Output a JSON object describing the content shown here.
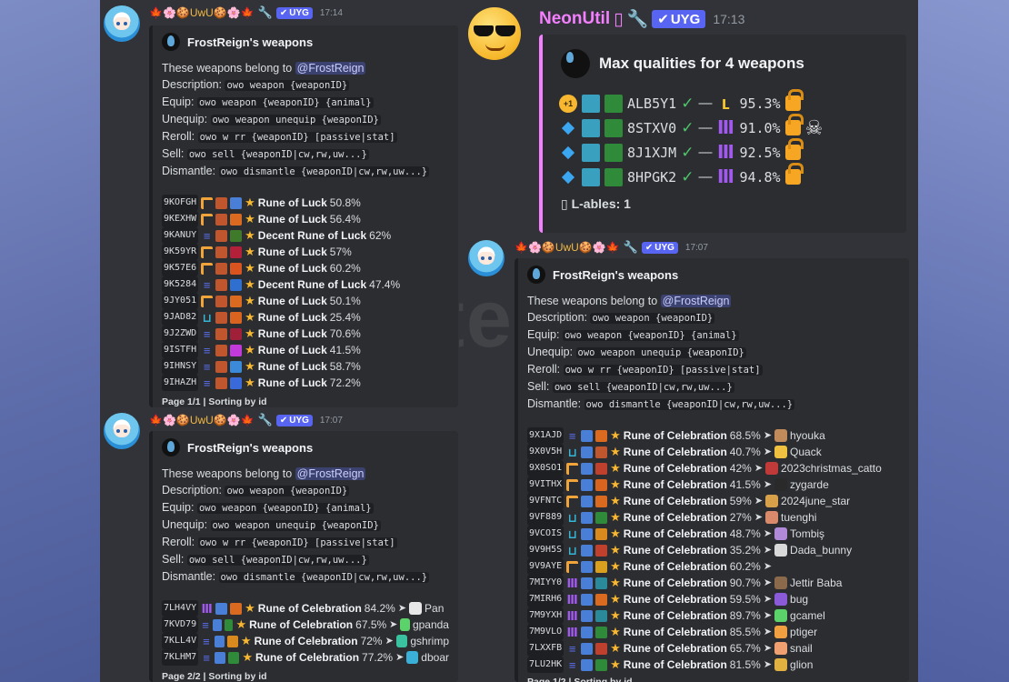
{
  "messages": {
    "left_top": {
      "author": "🍁🌸🍪UwU🍪🌸🍁",
      "tag": "UYG",
      "time": "17:14",
      "embed": {
        "title": "FrostReign's weapons",
        "intro_prefix": "These weapons belong to",
        "mention": "@FrostReign",
        "desc_label": "Description:",
        "desc_code": "owo weapon {weaponID}",
        "equip_label": "Equip:",
        "equip_code": "owo weapon {weaponID} {animal}",
        "unequip_label": "Unequip:",
        "unequip_code": "owo weapon unequip {weaponID}",
        "reroll_label": "Reroll:",
        "reroll_code": "owo w rr {weaponID} [passive|stat]",
        "sell_label": "Sell:",
        "sell_code": "owo sell {weaponID|cw,rw,uw...}",
        "dismantle_label": "Dismantle:",
        "dismantle_code": "owo dismantle {weaponID|cw,rw,uw...}",
        "rows": [
          {
            "id": "9KOFGH",
            "q": "C",
            "c1": "#c0562e",
            "c2": "#4a7fd8",
            "name": "Rune of Luck",
            "pct": "50.8%"
          },
          {
            "id": "9KEXHW",
            "q": "C",
            "c1": "#c0562e",
            "c2": "#d96a1f",
            "name": "Rune of Luck",
            "pct": "56.4%"
          },
          {
            "id": "9KANUY",
            "q": "E",
            "c1": "#c0562e",
            "c2": "#3f7a2a",
            "name": "Decent Rune of Luck",
            "pct": "62%"
          },
          {
            "id": "9K59YR",
            "q": "C",
            "c1": "#c0562e",
            "c2": "#b3203a",
            "name": "Rune of Luck",
            "pct": "57%"
          },
          {
            "id": "9K57E6",
            "q": "C",
            "c1": "#c0562e",
            "c2": "#d9541f",
            "name": "Rune of Luck",
            "pct": "60.2%"
          },
          {
            "id": "9K5284",
            "q": "E",
            "c1": "#c0562e",
            "c2": "#2f6fd0",
            "name": "Decent Rune of Luck",
            "pct": "47.4%"
          },
          {
            "id": "9JY051",
            "q": "C",
            "c1": "#c0562e",
            "c2": "#d96a1f",
            "name": "Rune of Luck",
            "pct": "50.1%"
          },
          {
            "id": "9JAD82",
            "q": "U",
            "c1": "#c0562e",
            "c2": "#d9641f",
            "name": "Rune of Luck",
            "pct": "25.4%"
          },
          {
            "id": "9J2ZWD",
            "q": "E",
            "c1": "#c0562e",
            "c2": "#a0203a",
            "name": "Rune of Luck",
            "pct": "70.6%"
          },
          {
            "id": "9ISTFH",
            "q": "E",
            "c1": "#c0562e",
            "c2": "#c23ad9",
            "name": "Rune of Luck",
            "pct": "41.5%"
          },
          {
            "id": "9IHNSY",
            "q": "E",
            "c1": "#c0562e",
            "c2": "#3a8ad9",
            "name": "Rune of Luck",
            "pct": "58.7%"
          },
          {
            "id": "9IHAZH",
            "q": "E",
            "c1": "#c0562e",
            "c2": "#3a6ad9",
            "name": "Rune of Luck",
            "pct": "72.2%"
          }
        ],
        "footer": "Page 1/1 | Sorting by id"
      }
    },
    "left_bottom": {
      "author": "🍁🌸🍪UwU🍪🌸🍁",
      "tag": "UYG",
      "time": "17:07",
      "embed": {
        "title": "FrostReign's weapons",
        "intro_prefix": "These weapons belong to",
        "mention": "@FrostReign",
        "desc_label": "Description:",
        "desc_code": "owo weapon {weaponID}",
        "equip_label": "Equip:",
        "equip_code": "owo weapon {weaponID} {animal}",
        "unequip_label": "Unequip:",
        "unequip_code": "owo weapon unequip {weaponID}",
        "reroll_label": "Reroll:",
        "reroll_code": "owo w rr {weaponID} [passive|stat]",
        "sell_label": "Sell:",
        "sell_code": "owo sell {weaponID|cw,rw,uw...}",
        "dismantle_label": "Dismantle:",
        "dismantle_code": "owo dismantle {weaponID|cw,rw,uw...}",
        "rows": [
          {
            "id": "7LH4VY",
            "q": "M",
            "c1": "#4a7fd8",
            "c2": "#d96a1f",
            "name": "Rune of Celebration",
            "pct": "84.2%",
            "pet": "Pan",
            "petc": "#e8e8e8"
          },
          {
            "id": "7KVD79",
            "q": "E",
            "c1": "#4a7fd8",
            "c2": "#2f8a3a",
            "name": "Rune of Celebration",
            "pct": "67.5%",
            "pet": "gpanda",
            "petc": "#5bd36a"
          },
          {
            "id": "7KLL4V",
            "q": "E",
            "c1": "#4a7fd8",
            "c2": "#d98a1f",
            "name": "Rune of Celebration",
            "pct": "72%",
            "pet": "gshrimp",
            "petc": "#3ac2a0"
          },
          {
            "id": "7KLHM7",
            "q": "E",
            "c1": "#4a7fd8",
            "c2": "#2f8a3a",
            "name": "Rune of Celebration",
            "pct": "77.2%",
            "pet": "dboar",
            "petc": "#3ab0d9"
          }
        ],
        "footer": "Page 2/2 | Sorting by id"
      }
    },
    "mid_top": {
      "author": "NeonUtil",
      "author_glyph": "▯",
      "tag": "UYG",
      "time": "17:13",
      "title": "Max qualities for 4 weapons",
      "rows": [
        {
          "marker": "+1",
          "code": "ALB5Y1",
          "q": "L",
          "pct": "95.3%",
          "skull": false
        },
        {
          "marker": "diamond",
          "code": "8STXV0",
          "q": "M",
          "pct": "91.0%",
          "skull": true
        },
        {
          "marker": "diamond",
          "code": "8J1XJM",
          "q": "M",
          "pct": "92.5%",
          "skull": false
        },
        {
          "marker": "diamond",
          "code": "8HPGK2",
          "q": "M",
          "pct": "94.8%",
          "skull": false
        }
      ],
      "lables": "▯ L-ables: 1"
    },
    "mid_bottom": {
      "author": "🍁🌸🍪UwU🍪🌸🍁",
      "tag": "UYG",
      "time": "17:07",
      "embed": {
        "title": "FrostReign's weapons",
        "intro_prefix": "These weapons belong to",
        "mention": "@FrostReign",
        "desc_label": "Description:",
        "desc_code": "owo weapon {weaponID}",
        "equip_label": "Equip:",
        "equip_code": "owo weapon {weaponID} {animal}",
        "unequip_label": "Unequip:",
        "unequip_code": "owo weapon unequip {weaponID}",
        "reroll_label": "Reroll:",
        "reroll_code": "owo w rr {weaponID} [passive|stat]",
        "sell_label": "Sell:",
        "sell_code": "owo sell {weaponID|cw,rw,uw...}",
        "dismantle_label": "Dismantle:",
        "dismantle_code": "owo dismantle {weaponID|cw,rw,uw...}",
        "rows": [
          {
            "id": "9X1AJD",
            "q": "E",
            "c1": "#4a7fd8",
            "c2": "#d96a1f",
            "name": "Rune of Celebration",
            "pct": "68.5%",
            "pet": "hyouka",
            "petc": "#c08a5a"
          },
          {
            "id": "9X0V5H",
            "q": "U",
            "c1": "#4a7fd8",
            "c2": "#c0562e",
            "name": "Rune of Celebration",
            "pct": "40.7%",
            "pet": "Quack",
            "petc": "#f0c040"
          },
          {
            "id": "9X0SO1",
            "q": "C",
            "c1": "#4a7fd8",
            "c2": "#c0402e",
            "name": "Rune of Celebration",
            "pct": "42%",
            "pet": "2023christmas_catto",
            "petc": "#c03a3a"
          },
          {
            "id": "9VITHX",
            "q": "C",
            "c1": "#4a7fd8",
            "c2": "#d9641f",
            "name": "Rune of Celebration",
            "pct": "41.5%",
            "pet": "zygarde",
            "petc": "#2a2a2a"
          },
          {
            "id": "9VFNTC",
            "q": "C",
            "c1": "#4a7fd8",
            "c2": "#d96a1f",
            "name": "Rune of Celebration",
            "pct": "59%",
            "pet": "2024june_star",
            "petc": "#d9a04a"
          },
          {
            "id": "9VF889",
            "q": "U",
            "c1": "#4a7fd8",
            "c2": "#2f8a3a",
            "name": "Rune of Celebration",
            "pct": "27%",
            "pet": "tuenghi",
            "petc": "#d98a6a"
          },
          {
            "id": "9VCOIS",
            "q": "U",
            "c1": "#4a7fd8",
            "c2": "#d98a1f",
            "name": "Rune of Celebration",
            "pct": "48.7%",
            "pet": "Tombiş",
            "petc": "#b08ad9"
          },
          {
            "id": "9V9H5S",
            "q": "U",
            "c1": "#4a7fd8",
            "c2": "#c0402e",
            "name": "Rune of Celebration",
            "pct": "35.2%",
            "pet": "Dada_bunny",
            "petc": "#d9d9d9"
          },
          {
            "id": "9V9AYE",
            "q": "C",
            "c1": "#4a7fd8",
            "c2": "#d9a01f",
            "name": "Rune of Celebration",
            "pct": "60.2%",
            "pet": "",
            "petc": ""
          },
          {
            "id": "7MIYY0",
            "q": "M",
            "c1": "#4a7fd8",
            "c2": "#2a8a9a",
            "name": "Rune of Celebration",
            "pct": "90.7%",
            "pet": "Jettir Baba",
            "petc": "#8a6a4a"
          },
          {
            "id": "7MIRH6",
            "q": "M",
            "c1": "#4a7fd8",
            "c2": "#d96a1f",
            "name": "Rune of Celebration",
            "pct": "59.5%",
            "pet": "bug",
            "petc": "#8a5ad9"
          },
          {
            "id": "7M9YXH",
            "q": "M",
            "c1": "#4a7fd8",
            "c2": "#2a8a9a",
            "name": "Rune of Celebration",
            "pct": "89.7%",
            "pet": "gcamel",
            "petc": "#5bd36a"
          },
          {
            "id": "7M9VLO",
            "q": "M",
            "c1": "#4a7fd8",
            "c2": "#2f8a3a",
            "name": "Rune of Celebration",
            "pct": "85.5%",
            "pet": "ptiger",
            "petc": "#f0a040"
          },
          {
            "id": "7LXXFB",
            "q": "E",
            "c1": "#4a7fd8",
            "c2": "#c0402e",
            "name": "Rune of Celebration",
            "pct": "65.7%",
            "pet": "snail",
            "petc": "#f0a070"
          },
          {
            "id": "7LU2HK",
            "q": "E",
            "c1": "#4a7fd8",
            "c2": "#2f8a3a",
            "name": "Rune of Celebration",
            "pct": "81.5%",
            "pet": "glion",
            "petc": "#e0b040"
          }
        ],
        "footer": "Page 1/2 | Sorting by id"
      }
    }
  },
  "colors": {
    "bg": "#313338",
    "embed": "#2b2d31",
    "accent_pink": "#f47fff",
    "badge": "#5865f2",
    "star": "#f7b731",
    "check": "#4fc46b"
  }
}
